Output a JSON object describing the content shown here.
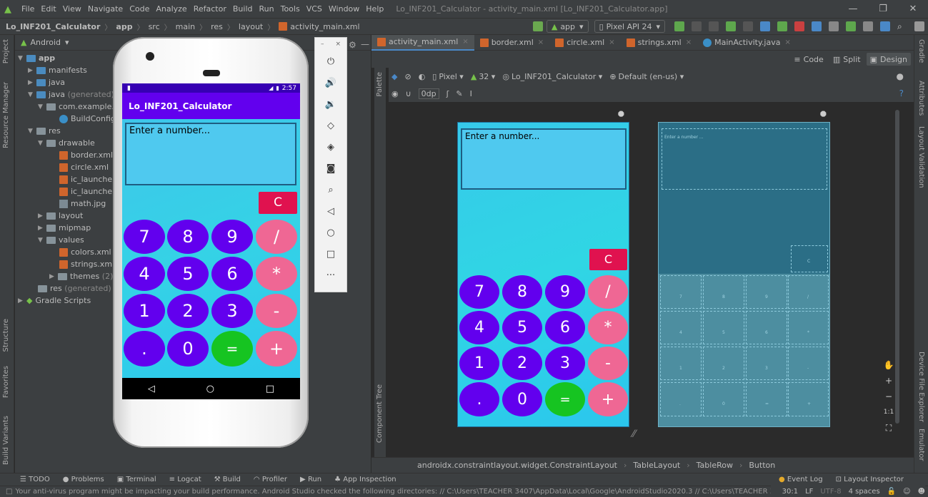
{
  "menu": {
    "items": [
      "File",
      "Edit",
      "View",
      "Navigate",
      "Code",
      "Analyze",
      "Refactor",
      "Build",
      "Run",
      "Tools",
      "VCS",
      "Window",
      "Help"
    ],
    "window_title": "Lo_INF201_Calculator - activity_main.xml [Lo_INF201_Calculator.app]"
  },
  "breadcrumb": [
    "Lo_INF201_Calculator",
    "app",
    "src",
    "main",
    "res",
    "layout",
    "activity_main.xml"
  ],
  "toolbar": {
    "run_config": "app",
    "device": "Pixel API 24"
  },
  "project": {
    "view_mode": "Android",
    "tree": [
      {
        "label": "app",
        "level": 0
      },
      {
        "label": "manifests",
        "level": 1
      },
      {
        "label": "java",
        "level": 1
      },
      {
        "label": "java",
        "suffix": "(generated)",
        "level": 1
      },
      {
        "label": "com.example.lo",
        "level": 2
      },
      {
        "label": "BuildConfig",
        "level": 3
      },
      {
        "label": "res",
        "level": 1
      },
      {
        "label": "drawable",
        "level": 2
      },
      {
        "label": "border.xml",
        "level": 3
      },
      {
        "label": "circle.xml",
        "level": 3
      },
      {
        "label": "ic_launcher_",
        "level": 3
      },
      {
        "label": "ic_launcher_",
        "level": 3
      },
      {
        "label": "math.jpg",
        "level": 3
      },
      {
        "label": "layout",
        "level": 2
      },
      {
        "label": "mipmap",
        "level": 2
      },
      {
        "label": "values",
        "level": 2
      },
      {
        "label": "colors.xml",
        "level": 3
      },
      {
        "label": "strings.xml",
        "level": 3
      },
      {
        "label": "themes",
        "suffix": "(2)",
        "level": 3
      },
      {
        "label": "res",
        "suffix": "(generated)",
        "level": 1
      },
      {
        "label": "Gradle Scripts",
        "level": 0
      }
    ]
  },
  "left_strip": {
    "project": "Project",
    "resource_manager": "Resource Manager",
    "structure": "Structure",
    "favorites": "Favorites",
    "build_variants": "Build Variants"
  },
  "right_strip": {
    "gradle": "Gradle",
    "attributes": "Attributes",
    "layout_validation": "Layout Validation",
    "device_file_explorer": "Device File Explorer",
    "emulator": "Emulator"
  },
  "emulator": {
    "time": "2:57",
    "app_title": "Lo_INF201_Calculator",
    "input_hint": "Enter a number...",
    "clear": "C",
    "keys": [
      [
        "7",
        "8",
        "9",
        "/"
      ],
      [
        "4",
        "5",
        "6",
        "*"
      ],
      [
        "1",
        "2",
        "3",
        "-"
      ],
      [
        ".",
        "0",
        "=",
        "+"
      ]
    ]
  },
  "tabs": [
    "activity_main.xml",
    "border.xml",
    "circle.xml",
    "strings.xml",
    "MainActivity.java"
  ],
  "design": {
    "modes": [
      "Code",
      "Split",
      "Design"
    ],
    "device_chip": "Pixel",
    "api_chip": "32",
    "theme_chip": "Lo_INF201_Calculator",
    "locale_chip": "Default (en-us)",
    "margin_chip": "0dp",
    "palette": "Palette",
    "component_tree": "Component Tree",
    "preview_hint": "Enter a number...",
    "blueprint_hint": "Enter a number ...",
    "clear": "C",
    "zoom_ratio": "1:1"
  },
  "component_path": [
    "androidx.constraintlayout.widget.ConstraintLayout",
    "TableLayout",
    "TableRow",
    "Button"
  ],
  "bottom_tools": [
    "TODO",
    "Problems",
    "Terminal",
    "Logcat",
    "Build",
    "Profiler",
    "Run",
    "App Inspection"
  ],
  "bottom_right": [
    "Event Log",
    "Layout Inspector"
  ],
  "status": {
    "message": "Your anti-virus program might be impacting your build performance. Android Studio checked the following directories: // C:\\Users\\TEACHER 3407\\AppData\\Local\\Google\\AndroidStudio2020.3 // C:\\Users\\TEACHER 3407\\Ap... (today 9:52",
    "position": "30:1",
    "line_sep": "LF",
    "encoding": "UTF-8",
    "indent": "4 spaces"
  },
  "colors": {
    "ide_bg": "#2b2b2b",
    "panel": "#3c3f41",
    "app_purple": "#6200ee",
    "key_pink": "#ef6794",
    "key_green": "#16c421",
    "clear_red": "#e0124f"
  }
}
